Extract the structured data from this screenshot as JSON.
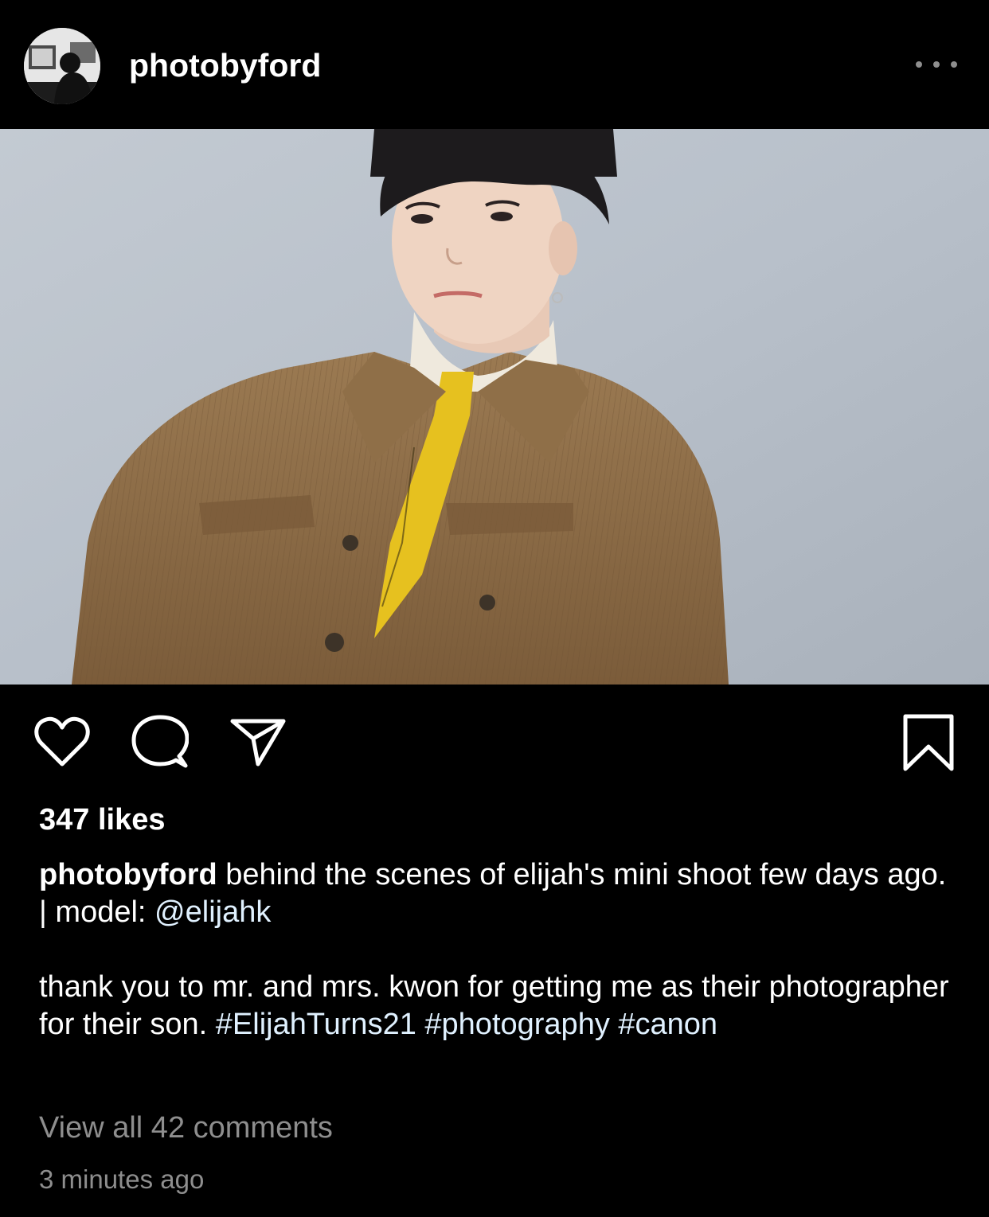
{
  "post": {
    "username": "photobyford",
    "likes": "347 likes",
    "caption": {
      "username": "photobyford",
      "text_1": " behind the scenes of elijah's mini shoot few days ago. | model: ",
      "mention": "@elijahk",
      "text_2": "thank you to mr. and mrs. kwon for getting me as their photographer for their son. ",
      "hashtags": [
        "#ElijahTurns21",
        "#photography",
        "#canon"
      ]
    },
    "view_comments": "View all 42 comments",
    "timestamp": "3 minutes ago"
  },
  "icons": {
    "more": "more-options-icon",
    "like": "heart-icon",
    "comment": "comment-bubble-icon",
    "share": "paper-plane-icon",
    "save": "bookmark-icon"
  },
  "colors": {
    "background": "#000000",
    "text": "#ffffff",
    "secondary": "#8e8e8e",
    "link": "#e0f1ff",
    "photo_backdrop": "#b9c1cb",
    "jacket": "#8a6a45",
    "tie": "#e9c21c"
  }
}
